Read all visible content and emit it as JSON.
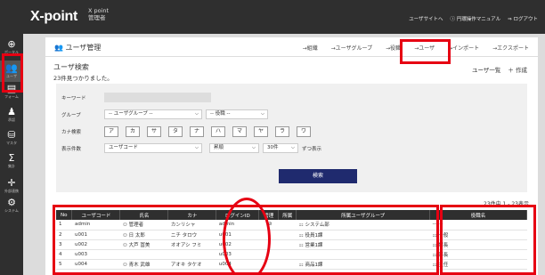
{
  "brand": {
    "logo": "X-point",
    "sub_line1": "X point",
    "sub_line2": "管理者"
  },
  "top_links": [
    "ユーザサイトへ",
    "ⓘ 円環操作マニュアル",
    "⇒ ログアウト"
  ],
  "sidebar": [
    {
      "icon": "globe-icon",
      "glyph": "⊕",
      "label": "ポータル"
    },
    {
      "icon": "users-icon",
      "glyph": "👥",
      "label": "ユーザ"
    },
    {
      "icon": "form-icon",
      "glyph": "▤",
      "label": "フォーム"
    },
    {
      "icon": "person-icon",
      "glyph": "♟",
      "label": "承認"
    },
    {
      "icon": "database-icon",
      "glyph": "⛁",
      "label": "マスタ"
    },
    {
      "icon": "sigma-icon",
      "glyph": "Σ",
      "label": "集計"
    },
    {
      "icon": "cross-icon",
      "glyph": "✛",
      "label": "外部連携"
    },
    {
      "icon": "gear-icon",
      "glyph": "⚙",
      "label": "システム"
    }
  ],
  "page": {
    "title": "ユーザ管理",
    "head_links": [
      "→組織",
      "→ユーザグループ",
      "→役職",
      "→ユーザ",
      "→インポート",
      "→エクスポート"
    ],
    "search_title": "ユーザ検索",
    "found": "23件見つかりました。",
    "actions": [
      "ユーザ一覧",
      "＋ 作成"
    ]
  },
  "form": {
    "keyword_label": "キーワード",
    "group_label": "グループ",
    "group_select": "-- ユーザグループ --",
    "role_select": "-- 役職 --",
    "kana_label": "カナ検索",
    "kana": [
      "ア",
      "カ",
      "サ",
      "タ",
      "ナ",
      "ハ",
      "マ",
      "ヤ",
      "ラ",
      "ワ"
    ],
    "display_label": "表示件数",
    "sort_select": "ユーザコード",
    "order_select": "昇順",
    "count_select": "30件",
    "display_suffix": "ずつ表示",
    "search_button": "検索"
  },
  "count_text": "23件中 1 - 23表示",
  "table": {
    "headers": [
      "No",
      "ユーザコード",
      "氏名",
      "カナ",
      "ログインID",
      "管理",
      "所属",
      "所属ユーザグループ",
      "役職名"
    ],
    "rows": [
      [
        "1",
        "admin",
        "管理者",
        "カンリシャ",
        "admin",
        "⊘",
        "",
        "システム部",
        "------"
      ],
      [
        "2",
        "u001",
        "日 太郎",
        "ニチ タロウ",
        "u001",
        "",
        "",
        "役員1課",
        "一般"
      ],
      [
        "3",
        "u002",
        "大芦 冨美",
        "オオアシ フミ",
        "u002",
        "",
        "",
        "営業1課",
        "課長"
      ],
      [
        "4",
        "u003",
        "",
        "",
        "u003",
        "",
        "",
        "",
        "部長"
      ],
      [
        "5",
        "u004",
        "青木 武雄",
        "アオキ タケオ",
        "u004",
        "",
        "",
        "商品1課",
        "主任"
      ]
    ]
  }
}
